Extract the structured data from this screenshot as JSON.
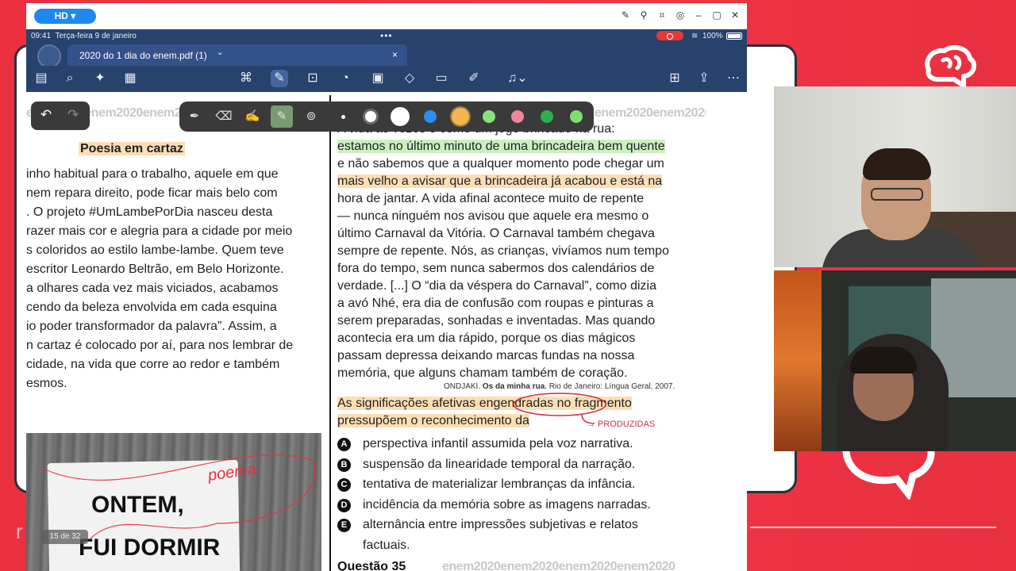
{
  "colors": {
    "brand_red": "#e8303f",
    "ios_navy": "#27426c",
    "highlight_green": "#a0e18c",
    "highlight_orange": "#facd8c",
    "highlight_pink": "#f5aab4"
  },
  "window": {
    "hd_label": "HD ▾"
  },
  "statusbar": {
    "time": "09:41",
    "date": "Terça-feira 9 de janeiro",
    "dots": "•••",
    "battery": "100%"
  },
  "tab": {
    "title": "2020 do 1 dia do enem.pdf (1)",
    "chevron": "⌄",
    "close": "×"
  },
  "toolbar_icons": [
    "sidebar-icon",
    "search-icon",
    "sparkle-icon",
    "document-icon",
    "lasso-icon",
    "pen-icon",
    "textbox-icon",
    "shapes-icon",
    "image-icon",
    "elements-icon",
    "sticky-note-icon",
    "laser-icon",
    "microphone-icon",
    "add-page-icon",
    "share-icon",
    "more-icon"
  ],
  "document": {
    "enem_strip": "enem2020enem2020enem2020enem2020",
    "left": {
      "title": "Poesia em cartaz",
      "lines": [
        "inho habitual para o trabalho, aquele em que",
        "nem repara direito, pode ficar mais belo com",
        ". O projeto #UmLambePorDia nasceu desta",
        "razer mais cor e alegria para a cidade por meio",
        "s coloridos ao estilo lambe-lambe. Quem teve",
        "escritor Leonardo Beltrão, em Belo Horizonte.",
        "a olhares cada vez mais viciados, acabamos",
        "cendo da beleza envolvida em cada esquina",
        "io poder transformador da palavra”. Assim, a",
        "n cartaz é colocado por aí, para nos lembrar de",
        "cidade, na vida que corre ao redor e também",
        "esmos."
      ],
      "poster_line1": "ONTEM,",
      "poster_line2": "FUI DORMIR",
      "page_indicator": "15 de 32",
      "handwriting": "poema"
    },
    "right": {
      "lines": [
        "A vida às vezes é como um jogo brincado na rua:",
        "estamos no último minuto de uma brincadeira bem quente",
        "e não sabemos que a qualquer momento pode chegar um",
        "mais velho a avisar que a brincadeira já acabou e está na",
        "hora de jantar. A vida afinal acontece muito de repente",
        "— nunca ninguém nos avisou que aquele era mesmo o",
        "último Carnaval da Vitória. O Carnaval também chegava",
        "sempre de repente. Nós, as crianças, vivíamos num tempo",
        "fora do tempo, sem nunca sabermos dos calendários de",
        "verdade. [...] O “dia da véspera do Carnaval”, como dizia",
        "a avó Nhé, era dia de confusão com roupas e pinturas a",
        "serem preparadas, sonhadas e inventadas. Mas quando",
        "acontecia era um dia rápido, porque os dias mágicos",
        "passam depressa deixando marcas fundas na nossa",
        "memória, que alguns chamam também de coração."
      ],
      "source_author": "ONDJAKI.",
      "source_title": "Os da minha rua",
      "source_rest": ". Rio de Janeiro: Língua Geral, 2007.",
      "question_line1": "As significações afetivas engendradas no fragmento",
      "question_line2": "pressupõem o reconhecimento da",
      "handwriting_note": "→ PRODUZIDAS",
      "options": [
        {
          "letter": "A",
          "text": "perspectiva infantil assumida pela voz narrativa."
        },
        {
          "letter": "B",
          "text": "suspensão da linearidade temporal da narração."
        },
        {
          "letter": "C",
          "text": "tentativa de materializar lembranças da infância."
        },
        {
          "letter": "D",
          "text": "incidência da memória sobre as imagens narradas."
        },
        {
          "letter": "E",
          "text": "alternância entre impressões subjetivas e relatos"
        }
      ],
      "option_e_cont": "factuais.",
      "next_question": "Questão 35"
    }
  },
  "pen_toolbar": {
    "undo": "↶",
    "redo": "↷",
    "tools": [
      "pen-tool-icon",
      "eraser-icon",
      "highlighter-icon",
      "marker-icon",
      "lasso-tool-icon"
    ],
    "colors": [
      "#ffffff",
      "#ffffff",
      "#2a8ff0",
      "#f4b453",
      "#8be07a",
      "#f2859a",
      "#29b14a",
      "#7fe06f"
    ]
  }
}
